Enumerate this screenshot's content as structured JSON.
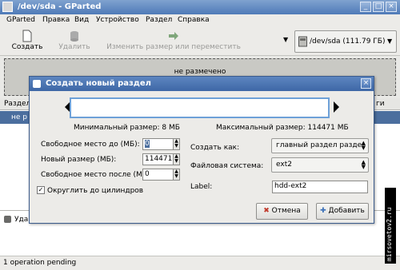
{
  "window": {
    "title": "/dev/sda - GParted"
  },
  "menubar": {
    "items": [
      "GParted",
      "Правка",
      "Вид",
      "Устройство",
      "Раздел",
      "Справка"
    ]
  },
  "toolbar": {
    "new_label": "Создать",
    "delete_label": "Удалить",
    "resize_label": "Изменить размер или переместить",
    "device_label": "/dev/sda   (111.79 ГБ)"
  },
  "main": {
    "unallocated_label": "не размечено",
    "table_header_left": "Раздел",
    "table_header_right": "ги",
    "row_left": "не р",
    "pending_item": "Уда",
    "status": "1 operation pending"
  },
  "dialog": {
    "title": "Создать новый раздел",
    "min_size": "Минимальный размер: 8 МБ",
    "max_size": "Максимальный размер: 114471 МБ",
    "free_before_label": "Свободное место до (МБ):",
    "free_before_value": "0",
    "new_size_label": "Новый размер (МБ):",
    "new_size_value": "114471",
    "free_after_label": "Свободное место после (МБ):",
    "free_after_value": "0",
    "round_label": "Округлить до цилиндров",
    "round_checked": true,
    "create_as_label": "Создать как:",
    "create_as_value": "главный раздел разде",
    "fs_label": "Файловая система:",
    "fs_value": "ext2",
    "label_label": "Label:",
    "label_value": "hdd-ext2",
    "cancel_label": "Отмена",
    "add_label": "Добавить"
  },
  "watermark": "mirsovetov2.ru",
  "colors": {
    "titlebar": "#4f7ab8",
    "selection": "#4b6e9e",
    "partition_border": "#6ea1d8"
  }
}
